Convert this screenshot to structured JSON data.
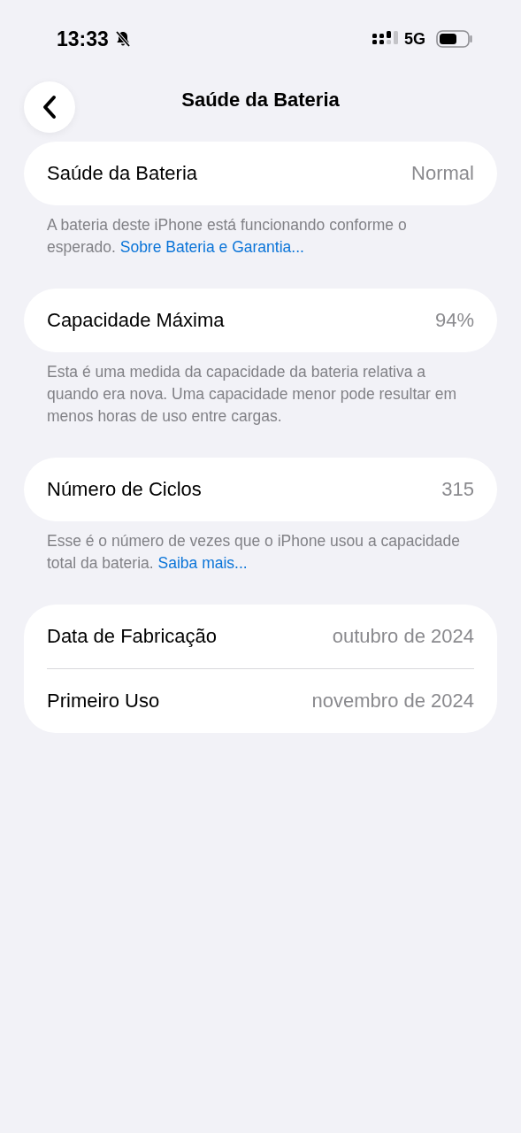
{
  "status_bar": {
    "time": "13:33",
    "silent": true,
    "network": "5G"
  },
  "nav": {
    "title": "Saúde da Bateria"
  },
  "sections": [
    {
      "rows": [
        {
          "label": "Saúde da Bateria",
          "value": "Normal"
        }
      ],
      "footer": {
        "text": "A bateria deste iPhone está funcionando conforme o esperado.",
        "link": "Sobre Bateria e Garantia..."
      }
    },
    {
      "rows": [
        {
          "label": "Capacidade Máxima",
          "value": "94%"
        }
      ],
      "footer": {
        "text": "Esta é uma medida da capacidade da bateria relativa a quando era nova. Uma capacidade menor pode resultar em menos horas de uso entre cargas."
      }
    },
    {
      "rows": [
        {
          "label": "Número de Ciclos",
          "value": "315"
        }
      ],
      "footer": {
        "text": "Esse é o número de vezes que o iPhone usou a capacidade total da bateria.",
        "link": "Saiba mais..."
      }
    },
    {
      "rows": [
        {
          "label": "Data de Fabricação",
          "value": "outubro de 2024"
        },
        {
          "label": "Primeiro Uso",
          "value": "novembro de 2024"
        }
      ]
    }
  ]
}
